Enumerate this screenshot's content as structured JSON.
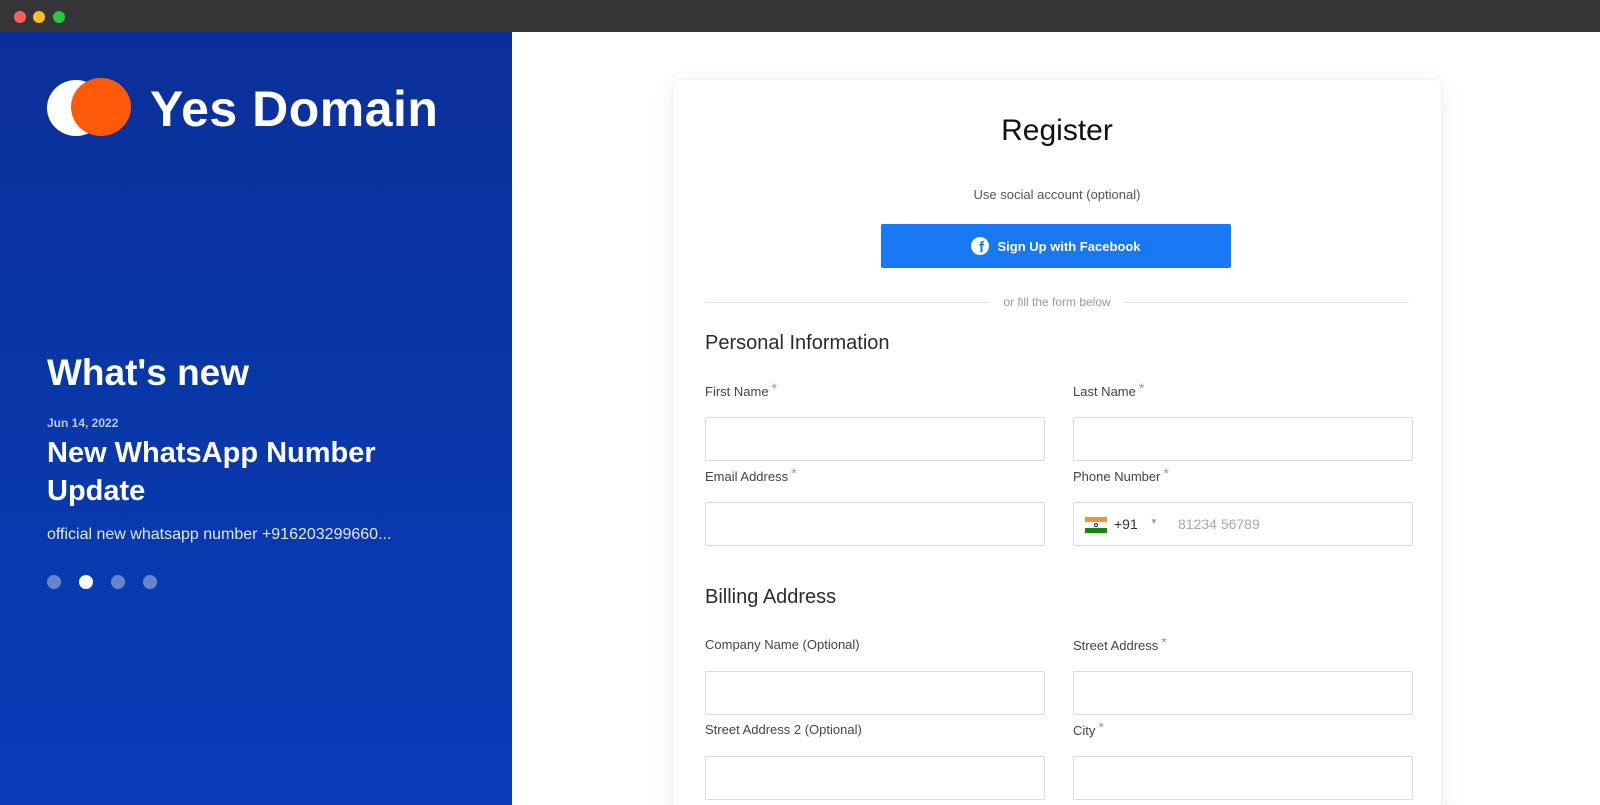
{
  "window": {
    "controls": [
      "close",
      "minimize",
      "maximize"
    ]
  },
  "sidebar": {
    "brand": "Yes Domain",
    "logo_colors": {
      "left_circle": "#ffffff",
      "right_circle": "#ff5a0a"
    },
    "background": "#0a36a8",
    "whats_new": "What's new",
    "news": {
      "date": "Jun 14, 2022",
      "title": "New WhatsApp Number Update",
      "excerpt": "official new whatsapp number +916203299660..."
    },
    "carousel": {
      "total": 4,
      "active_index": 1
    }
  },
  "form": {
    "title": "Register",
    "social_caption": "Use social account (optional)",
    "facebook_button": "Sign Up with Facebook",
    "facebook_color": "#1877f2",
    "divider_text": "or fill the form below",
    "required_mark": "*",
    "personal_section": "Personal Information",
    "first_name": {
      "label": "First Name",
      "value": ""
    },
    "last_name": {
      "label": "Last Name",
      "value": ""
    },
    "email": {
      "label": "Email Address",
      "value": ""
    },
    "phone": {
      "label": "Phone Number",
      "country_flag": "india-flag-icon",
      "dial_code": "+91",
      "placeholder": "81234 56789",
      "value": ""
    },
    "billing_section": "Billing Address",
    "company": {
      "label": "Company Name (Optional)",
      "value": ""
    },
    "street": {
      "label": "Street Address",
      "value": ""
    },
    "street2": {
      "label": "Street Address 2 (Optional)",
      "value": ""
    },
    "city": {
      "label": "City",
      "value": ""
    }
  }
}
